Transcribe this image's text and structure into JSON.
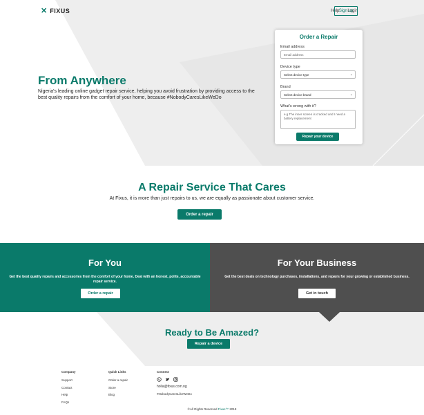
{
  "nav": {
    "logo_mark": "✕",
    "logo_text": "FIXUS",
    "help": "Help",
    "login": "Login",
    "signup": "Sign up"
  },
  "hero": {
    "title": "From Anywhere",
    "description": "Nigeria's leading online gadget repair service, helping you avoid frustration by providing access to the best quality repairs from the comfort of your home, because #NobodyCaresLikeWeDo"
  },
  "form": {
    "title": "Order a Repair",
    "email_label": "Email address",
    "email_placeholder": "Email address",
    "device_label": "Device type",
    "device_value": "Select device type",
    "brand_label": "Brand",
    "brand_value": "Select device brand",
    "issue_label": "What's wrong with it?",
    "issue_placeholder": "e.g The inner screen is cracked and I need a battery replacement",
    "submit": "Repair your device"
  },
  "cares": {
    "title": "A Repair Service That Cares",
    "description": "At Fixus, it is more than just repairs to us, we are equally as passionate about customer service.",
    "button": "Order a repair"
  },
  "for_you": {
    "title": "For You",
    "description": "Get the best quality repairs and accessories from the comfort of your home. Deal with an honest, polite, accountable repair service.",
    "button": "Order a repair"
  },
  "for_business": {
    "title": "For Your Business",
    "description": "Get the best deals on technology purchases, installations, and repairs for your growing or established business.",
    "button": "Get in touch"
  },
  "amazed": {
    "title": "Ready to Be Amazed?",
    "button": "Repair a device"
  },
  "footer": {
    "company": {
      "heading": "Company",
      "links": [
        "Support",
        "Contact",
        "Help",
        "FAQs"
      ]
    },
    "quick": {
      "heading": "Quick Links",
      "links": [
        "Order a repair",
        "Store",
        "Blog"
      ]
    },
    "connect": {
      "heading": "Connect",
      "email": "holla@fixus.com.ng",
      "hashtag": "#NobodyCaresLikeWeDo"
    },
    "copyright_prefix": "©All Rights Reserved",
    "copyright_brand": "Fixus™",
    "copyright_year": "2018"
  },
  "colors": {
    "accent": "#0a7a6a",
    "business_bg": "#4f4f4f"
  },
  "icons": [
    "whatsapp-icon",
    "twitter-icon",
    "instagram-icon"
  ]
}
